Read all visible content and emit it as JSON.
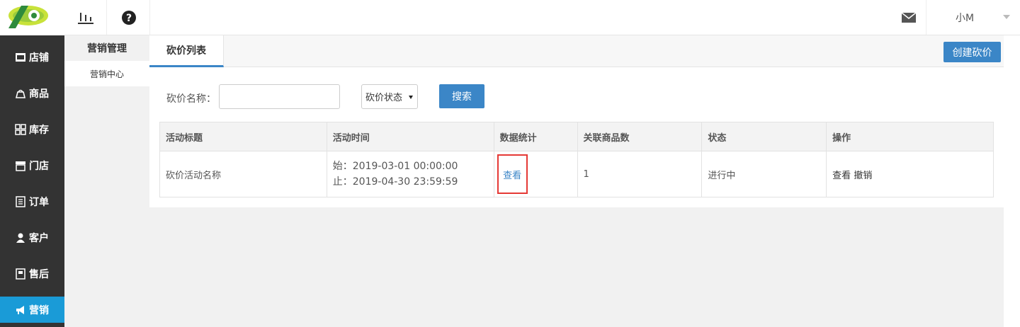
{
  "header": {
    "user_name": "小M",
    "icons": [
      "logo-icon",
      "stats-icon",
      "help-icon",
      "mail-icon",
      "caret-down-icon"
    ]
  },
  "leftnav": {
    "items": [
      {
        "label": "店铺",
        "icon": "store-icon"
      },
      {
        "label": "商品",
        "icon": "goods-icon"
      },
      {
        "label": "库存",
        "icon": "grid-icon"
      },
      {
        "label": "门店",
        "icon": "shop-icon"
      },
      {
        "label": "订单",
        "icon": "order-icon"
      },
      {
        "label": "客户",
        "icon": "user-icon"
      },
      {
        "label": "售后",
        "icon": "aftersale-icon"
      },
      {
        "label": "营销",
        "icon": "megaphone-icon"
      }
    ],
    "active_color": "#1a9bd7"
  },
  "subnav": {
    "title": "营销管理",
    "item": "营销中心"
  },
  "main": {
    "tab_label": "砍价列表",
    "create_label": "创建砍价",
    "filter": {
      "name_label": "砍价名称：",
      "name_value": "",
      "status_label": "砍价状态",
      "search_label": "搜索"
    },
    "table": {
      "headers": [
        "活动标题",
        "活动时间",
        "数据统计",
        "关联商品数",
        "状态",
        "操作"
      ],
      "rows": [
        {
          "title": "砍价活动名称",
          "start": "始：2019-03-01 00:00:00",
          "end": "止：2019-04-30 23:59:59",
          "stats": "查看",
          "goods_count": "1",
          "status": "进行中",
          "op_view": "查看",
          "op_cancel": "撤销"
        }
      ]
    }
  },
  "colors": {
    "accent": "#3b86c7",
    "highlight_border": "#e53935",
    "nav_bg": "#333333"
  }
}
